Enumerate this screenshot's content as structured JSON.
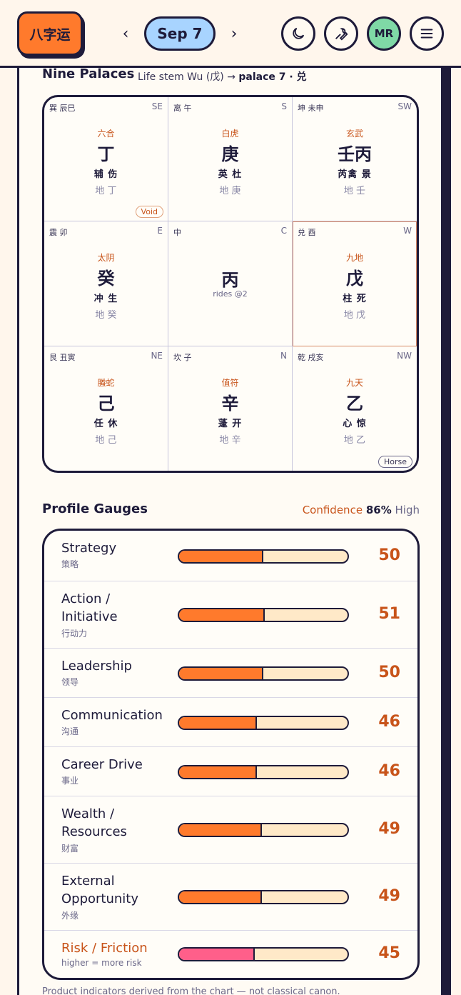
{
  "header": {
    "logo_text": "八字运",
    "prev_label": "‹",
    "date_label": "Sep 7",
    "next_label": "›",
    "avatar_initials": "MR"
  },
  "nine_palaces": {
    "title": "Nine Palaces",
    "subtitle_prefix": "Life stem Wu (戊) →",
    "subtitle_bold": "palace 7 · 兑",
    "cells": [
      {
        "tl": "巽 辰巳",
        "tr": "SE",
        "deity": "六合",
        "stem": "丁",
        "star": "辅 伤",
        "earth": "地 丁",
        "chip": "Void"
      },
      {
        "tl": "离 午",
        "tr": "S",
        "deity": "白虎",
        "stem": "庚",
        "star": "英 杜",
        "earth": "地 庚",
        "chip": ""
      },
      {
        "tl": "坤 未申",
        "tr": "SW",
        "deity": "玄武",
        "stem": "壬丙",
        "star": "芮禽 景",
        "earth": "地 壬",
        "chip": ""
      },
      {
        "tl": "震 卯",
        "tr": "E",
        "deity": "太阴",
        "stem": "癸",
        "star": "冲 生",
        "earth": "地 癸",
        "chip": ""
      },
      {
        "tl": "中",
        "tr": "C",
        "deity": "",
        "stem": "丙",
        "star": "",
        "earth": "",
        "rides": "rides @2",
        "chip": ""
      },
      {
        "tl": "兑 酉",
        "tr": "W",
        "deity": "九地",
        "stem": "戊",
        "star": "柱 死",
        "earth": "地 戊",
        "chip": ""
      },
      {
        "tl": "艮 丑寅",
        "tr": "NE",
        "deity": "螣蛇",
        "stem": "己",
        "star": "任 休",
        "earth": "地 己",
        "chip": ""
      },
      {
        "tl": "坎 子",
        "tr": "N",
        "deity": "值符",
        "stem": "辛",
        "star": "蓬 开",
        "earth": "地 辛",
        "chip": ""
      },
      {
        "tl": "乾 戌亥",
        "tr": "NW",
        "deity": "九天",
        "stem": "乙",
        "star": "心 惊",
        "earth": "地 乙",
        "chip": "Horse"
      }
    ]
  },
  "profile_gauges": {
    "title": "Profile Gauges",
    "confidence_label": "Confidence",
    "confidence_value": "86%",
    "confidence_level": "High",
    "items": [
      {
        "label": "Strategy",
        "sub": "策略",
        "value": 50
      },
      {
        "label": "Action / Initiative",
        "sub": "行动力",
        "value": 51
      },
      {
        "label": "Leadership",
        "sub": "领导",
        "value": 50
      },
      {
        "label": "Communication",
        "sub": "沟通",
        "value": 46
      },
      {
        "label": "Career Drive",
        "sub": "事业",
        "value": 46
      },
      {
        "label": "Wealth / Resources",
        "sub": "财富",
        "value": 49
      },
      {
        "label": "External Opportunity",
        "sub": "外缘",
        "value": 49
      },
      {
        "label": "Risk / Friction",
        "sub": "higher = more risk",
        "value": 45
      }
    ]
  },
  "footnote": "Product indicators derived from the chart — not classical canon."
}
